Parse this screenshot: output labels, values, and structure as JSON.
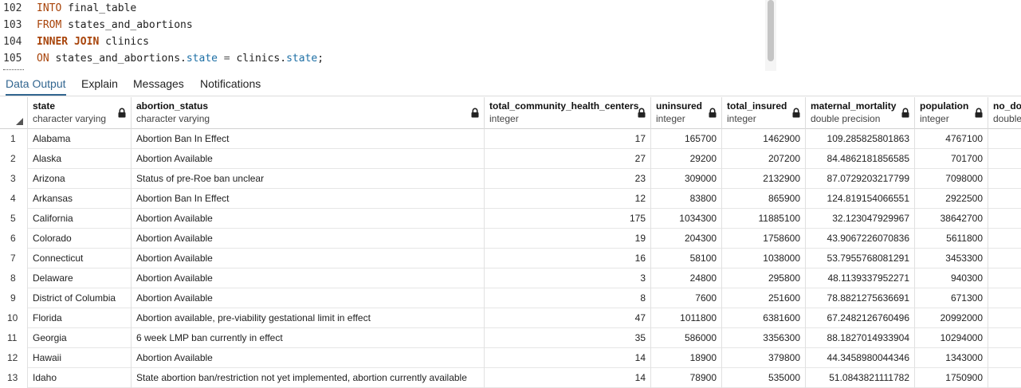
{
  "editor": {
    "lines": [
      {
        "num": "102",
        "tokens": [
          {
            "t": "INTO",
            "c": "kw"
          },
          {
            "t": " final_table",
            "c": "plain"
          }
        ]
      },
      {
        "num": "103",
        "tokens": [
          {
            "t": "FROM",
            "c": "kw"
          },
          {
            "t": " states_and_abortions",
            "c": "plain"
          }
        ]
      },
      {
        "num": "104",
        "tokens": [
          {
            "t": "INNER JOIN",
            "c": "kw-b"
          },
          {
            "t": " clinics",
            "c": "plain"
          }
        ]
      },
      {
        "num": "105",
        "tokens": [
          {
            "t": "ON",
            "c": "kw"
          },
          {
            "t": " states_and_abortions.",
            "c": "plain"
          },
          {
            "t": "state",
            "c": "prop"
          },
          {
            "t": " = ",
            "c": "op"
          },
          {
            "t": "clinics.",
            "c": "plain"
          },
          {
            "t": "state",
            "c": "prop"
          },
          {
            "t": ";",
            "c": "plain"
          }
        ]
      }
    ]
  },
  "tabs": [
    {
      "label": "Data Output",
      "active": true
    },
    {
      "label": "Explain",
      "active": false
    },
    {
      "label": "Messages",
      "active": false
    },
    {
      "label": "Notifications",
      "active": false
    }
  ],
  "grid": {
    "columns": [
      {
        "name": "state",
        "type": "character varying",
        "numeric": false
      },
      {
        "name": "abortion_status",
        "type": "character varying",
        "numeric": false
      },
      {
        "name": "total_community_health_centers",
        "type": "integer",
        "numeric": true
      },
      {
        "name": "uninsured",
        "type": "integer",
        "numeric": true
      },
      {
        "name": "total_insured",
        "type": "integer",
        "numeric": true
      },
      {
        "name": "maternal_mortality",
        "type": "double precision",
        "numeric": true
      },
      {
        "name": "population",
        "type": "integer",
        "numeric": true
      },
      {
        "name": "no_do",
        "type": "double",
        "numeric": true
      }
    ],
    "rows": [
      {
        "idx": "1",
        "cells": [
          "Alabama",
          "Abortion Ban In Effect",
          "17",
          "165700",
          "1462900",
          "109.285825801863",
          "4767100",
          ""
        ]
      },
      {
        "idx": "2",
        "cells": [
          "Alaska",
          "Abortion Available",
          "27",
          "29200",
          "207200",
          "84.4862181856585",
          "701700",
          ""
        ]
      },
      {
        "idx": "3",
        "cells": [
          "Arizona",
          "Status of pre-Roe ban unclear",
          "23",
          "309000",
          "2132900",
          "87.0729203217799",
          "7098000",
          ""
        ]
      },
      {
        "idx": "4",
        "cells": [
          "Arkansas",
          "Abortion Ban In Effect",
          "12",
          "83800",
          "865900",
          "124.819154066551",
          "2922500",
          ""
        ]
      },
      {
        "idx": "5",
        "cells": [
          "California",
          "Abortion Available",
          "175",
          "1034300",
          "11885100",
          "32.123047929967",
          "38642700",
          ""
        ]
      },
      {
        "idx": "6",
        "cells": [
          "Colorado",
          "Abortion Available",
          "19",
          "204300",
          "1758600",
          "43.9067226070836",
          "5611800",
          ""
        ]
      },
      {
        "idx": "7",
        "cells": [
          "Connecticut",
          "Abortion Available",
          "16",
          "58100",
          "1038000",
          "53.7955768081291",
          "3453300",
          ""
        ]
      },
      {
        "idx": "8",
        "cells": [
          "Delaware",
          "Abortion Available",
          "3",
          "24800",
          "295800",
          "48.1139337952271",
          "940300",
          ""
        ]
      },
      {
        "idx": "9",
        "cells": [
          "District of Columbia",
          "Abortion Available",
          "8",
          "7600",
          "251600",
          "78.8821275636691",
          "671300",
          ""
        ]
      },
      {
        "idx": "10",
        "cells": [
          "Florida",
          "Abortion available, pre-viability gestational limit in effect",
          "47",
          "1011800",
          "6381600",
          "67.2482126760496",
          "20992000",
          ""
        ]
      },
      {
        "idx": "11",
        "cells": [
          "Georgia",
          "6 week LMP ban currently in effect",
          "35",
          "586000",
          "3356300",
          "88.1827014933904",
          "10294000",
          ""
        ]
      },
      {
        "idx": "12",
        "cells": [
          "Hawaii",
          "Abortion Available",
          "14",
          "18900",
          "379800",
          "44.3458980044346",
          "1343000",
          ""
        ]
      },
      {
        "idx": "13",
        "cells": [
          "Idaho",
          "State abortion ban/restriction not yet implemented, abortion currently available",
          "14",
          "78900",
          "535000",
          "51.0843821111782",
          "1750900",
          ""
        ]
      }
    ]
  }
}
